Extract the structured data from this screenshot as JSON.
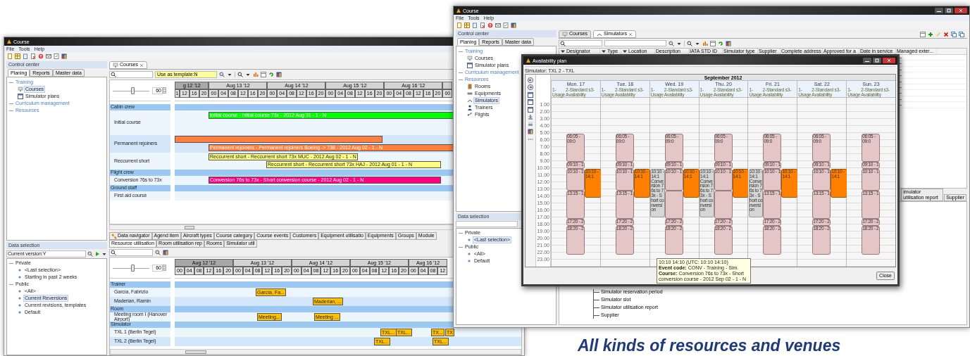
{
  "left_window": {
    "title": "Course",
    "menu": [
      "File",
      "Tools",
      "Help"
    ],
    "control_center": {
      "title": "Control center",
      "tabs": [
        {
          "label": "Planing",
          "selected": true
        },
        {
          "label": "Reports",
          "selected": false
        },
        {
          "label": "Master data",
          "selected": false
        }
      ],
      "tree": [
        {
          "label": "Training",
          "kind": "category",
          "selected": false,
          "children": [
            {
              "label": "Courses",
              "kind": "course",
              "selected": true
            },
            {
              "label": "Simulator plans",
              "kind": "plan",
              "selected": false
            }
          ]
        },
        {
          "label": "Curriculum management",
          "kind": "category",
          "selected": false
        },
        {
          "label": "Resources",
          "kind": "category",
          "selected": false
        }
      ]
    },
    "data_selection": {
      "title": "Data selection",
      "filter": "Current version:Y",
      "tree": [
        {
          "label": "Private",
          "kind": "folder",
          "selected": false,
          "children": [
            {
              "label": "<Last selection>",
              "kind": "filter",
              "selected": false
            },
            {
              "label": "Starting in past 2 weeks",
              "kind": "filter",
              "selected": false
            }
          ]
        },
        {
          "label": "Public",
          "kind": "folder",
          "selected": false,
          "children": [
            {
              "label": "<All>",
              "kind": "filter",
              "selected": false
            },
            {
              "label": "Current Reversions",
              "kind": "filter",
              "selected": true
            },
            {
              "label": "Current revisions, templates",
              "kind": "filter",
              "selected": false
            },
            {
              "label": "Default",
              "kind": "filter",
              "selected": false
            }
          ]
        }
      ]
    },
    "editor": {
      "tabs": [
        {
          "label": "Courses",
          "selected": true
        }
      ],
      "template_field": "Use as template:N",
      "planner": {
        "zoom": "60",
        "level": 0.55,
        "days": [
          {
            "label": "g 12 '12",
            "weekend": true,
            "hours": [
              "1",
              "12",
              "16",
              "20"
            ]
          },
          {
            "label": "Aug 13 '12",
            "weekend": false,
            "hours": [
              "00",
              "04",
              "08",
              "12",
              "16",
              "20"
            ]
          },
          {
            "label": "Aug 14 '12",
            "weekend": false,
            "hours": [
              "00",
              "04",
              "08",
              "12",
              "16",
              "20"
            ]
          },
          {
            "label": "Aug 15 '12",
            "weekend": false,
            "hours": [
              "00",
              "04",
              "08",
              "12",
              "16",
              "20"
            ]
          },
          {
            "label": "Aug 16 '12",
            "weekend": false,
            "hours": [
              "00",
              "04",
              "08",
              "12",
              "16",
              "20"
            ]
          },
          {
            "weekend": false,
            "hours": [
              "00"
            ]
          }
        ],
        "rows": [
          {
            "kind": "group",
            "label": "Cabin crew"
          },
          {
            "kind": "item",
            "label": "Initial course",
            "bars": [
              {
                "label": "Initial course - Initial course 73x - 2012 Aug 01 - 1 - N",
                "color": "#00ff00"
              }
            ]
          },
          {
            "kind": "item",
            "label": "Permanent rejoiners",
            "bars": [
              {
                "color": "#ff7f3f"
              },
              {
                "label": "Permanent rejoiners - Permanent rejoiners Boeing -> 738 - 2012 Aug 02 - 1 - N",
                "color": "#ff7f3f"
              }
            ]
          },
          {
            "kind": "item",
            "label": "Reccurrent short",
            "bars": [
              {
                "label": "Reccurrent short - Reccurrent short 73x MUC - 2012 Aug 02 - 1 - N",
                "color": "#ffff80"
              },
              {
                "label": "Reccurrent short - Reccurrent short 73x HAJ - 2012 Aug 01 - 1 - N",
                "color": "#ffff80"
              }
            ]
          },
          {
            "kind": "group",
            "label": "Flight crew"
          },
          {
            "kind": "item",
            "label": "Conversion 76s to 73x",
            "bars": [
              {
                "label": "Conversion 76s to 73x - Short conversion course - 2012 Aug 02 - 1 - N",
                "color": "#ff0080"
              }
            ]
          },
          {
            "kind": "group",
            "label": "Ground staff"
          },
          {
            "kind": "item",
            "label": "First aid course",
            "bars": []
          }
        ]
      }
    },
    "bottom_panel": {
      "tabs": [
        {
          "label": "Data navigator",
          "selected": false
        },
        {
          "label": "Agend item",
          "selected": false
        },
        {
          "label": "Aircraft types",
          "selected": false
        },
        {
          "label": "Course category",
          "selected": false
        },
        {
          "label": "Course events",
          "selected": false
        },
        {
          "label": "Customers",
          "selected": false
        },
        {
          "label": "Equipment utilisatio",
          "selected": false
        },
        {
          "label": "Equipments",
          "selected": false
        },
        {
          "label": "Groups",
          "selected": false
        },
        {
          "label": "Module",
          "selected": false
        },
        {
          "label": "Resource utilisation",
          "selected": true
        },
        {
          "label": "Room utilisation rep",
          "selected": false
        },
        {
          "label": "Rooms",
          "selected": false
        },
        {
          "label": "Simulator util",
          "selected": false
        }
      ],
      "planner": {
        "zoom": "60",
        "level": 0.55,
        "days": [
          {
            "label": "Aug 12 '12",
            "weekend": true,
            "hours": [
              "00",
              "04",
              "08",
              "12",
              "16",
              "20"
            ]
          },
          {
            "label": "Aug 13 '12",
            "weekend": false,
            "hours": [
              "00",
              "04",
              "08",
              "12",
              "16",
              "20"
            ]
          },
          {
            "label": "Aug 14 '12",
            "weekend": false,
            "hours": [
              "00",
              "04",
              "08",
              "12",
              "16",
              "20"
            ]
          },
          {
            "label": "Aug 15 '12",
            "weekend": false,
            "hours": [
              "00",
              "04",
              "08",
              "12",
              "16",
              "20"
            ]
          },
          {
            "label": "Aug 16 '12",
            "weekend": false,
            "hours": [
              "00",
              "04",
              "08",
              "12"
            ]
          }
        ],
        "rows": [
          {
            "kind": "group",
            "label": "Trainer"
          },
          {
            "kind": "item",
            "label": "García, Fabrizio",
            "bars": [
              {
                "label": "García, Fa...",
                "color": "#ffc000"
              }
            ]
          },
          {
            "kind": "item",
            "label": "Maderian, Ramin",
            "bars": [
              {
                "label": "Maderian, ...",
                "color": "#ffc000"
              }
            ]
          },
          {
            "kind": "group",
            "label": "Room"
          },
          {
            "kind": "item",
            "label": "Meeting room I (Hanover Airport)",
            "bars": [
              {
                "label": "Meeting...",
                "color": "#ffc000"
              },
              {
                "label": "Meeting ...",
                "color": "#ffc000"
              }
            ]
          },
          {
            "kind": "group",
            "label": "Simulator"
          },
          {
            "kind": "item",
            "label": "TXL 1 (Berlin Tegel)",
            "bars": [
              {
                "label": "TXL...",
                "color": "#ffc000"
              },
              {
                "label": "TXL...",
                "color": "#ffc000"
              },
              {
                "label": "TX...",
                "color": "#ffc000"
              },
              {
                "label": "TX",
                "color": "#ffc000"
              }
            ]
          },
          {
            "kind": "item",
            "label": "TXL 2 (Berlin Tegel)",
            "bars": [
              {
                "label": "TXL...",
                "color": "#ffc000"
              },
              {
                "label": "TXL...",
                "color": "#ffc000"
              }
            ]
          }
        ]
      }
    }
  },
  "right_window": {
    "title": "Course",
    "menu": [
      "File",
      "Tools",
      "Help"
    ],
    "control_center": {
      "title": "Control center",
      "tabs": [
        {
          "label": "Planing",
          "selected": true
        },
        {
          "label": "Reports",
          "selected": false
        },
        {
          "label": "Master data",
          "selected": false
        }
      ],
      "tree": [
        {
          "label": "Training",
          "kind": "category",
          "selected": false,
          "children": [
            {
              "label": "Courses",
              "kind": "course",
              "selected": false
            },
            {
              "label": "Simulator plans",
              "kind": "plan",
              "selected": false
            }
          ]
        },
        {
          "label": "Curriculum management",
          "kind": "category",
          "selected": false
        },
        {
          "label": "Resources",
          "kind": "category",
          "selected": false,
          "children": [
            {
              "label": "Rooms",
              "kind": "room",
              "selected": false
            },
            {
              "label": "Equipments",
              "kind": "equipment",
              "selected": false
            },
            {
              "label": "Simulators",
              "kind": "simulator",
              "selected": true
            },
            {
              "label": "Trainers",
              "kind": "trainer",
              "selected": false
            },
            {
              "label": "Flights",
              "kind": "flight",
              "selected": false
            }
          ]
        }
      ]
    },
    "data_selection": {
      "title": "Data selection",
      "tree": [
        {
          "label": "Private",
          "kind": "folder",
          "selected": false,
          "children": [
            {
              "label": "<Last selection>",
              "kind": "filter",
              "selected": true
            }
          ]
        },
        {
          "label": "Public",
          "kind": "folder",
          "selected": false,
          "children": [
            {
              "label": "<All>",
              "kind": "filter",
              "selected": false
            },
            {
              "label": "Default",
              "kind": "filter",
              "selected": false
            }
          ]
        }
      ]
    },
    "editor": {
      "tabs": [
        {
          "label": "Courses",
          "selected": false
        },
        {
          "label": "Simulators",
          "selected": true
        }
      ],
      "columns": [
        {
          "label": "Designator",
          "filter": true
        },
        {
          "label": "Type",
          "filter": true
        },
        {
          "label": "Location",
          "filter": true
        },
        {
          "label": "Description",
          "filter": false
        },
        {
          "label": "IATA STD ID",
          "filter": false
        },
        {
          "label": "Simulator type",
          "filter": false
        },
        {
          "label": "Supplier",
          "filter": false
        },
        {
          "label": "Complete address",
          "filter": false
        },
        {
          "label": "Approved for a",
          "filter": false
        },
        {
          "label": "Date in service",
          "filter": false
        },
        {
          "label": "Managed exter...",
          "filter": false
        }
      ],
      "managed_column_cells": [
        "–",
        "–",
        "–",
        "–",
        "–",
        "–",
        "–",
        "–",
        "–"
      ],
      "bottom_tabs": [
        {
          "label": "imulator utilisation report",
          "selected": false
        },
        {
          "label": "Supplier",
          "selected": false
        }
      ],
      "outline": [
        "Simulator reservation period",
        "Simulator slot",
        "Simulator utilisation report",
        "Supplier"
      ]
    }
  },
  "dialog": {
    "title": "Availability plan",
    "simulator": "Simulator: TXL 2 - TXL",
    "month": "September 2012",
    "hours": [
      "1.00",
      "2.00",
      "3.00",
      "4.00",
      "5.00",
      "6.00",
      "7.00",
      "8.00",
      "9.00",
      "10.00",
      "11.00",
      "12.00",
      "13.00",
      "14.00",
      "15.00",
      "16.00",
      "17.00",
      "18.00",
      "19.00",
      "20.00",
      "21.00",
      "22.00",
      "23.00"
    ],
    "days": [
      {
        "label": "Mon. 17",
        "columns": [
          "1-Usage",
          "2-Standard s3-Availability"
        ],
        "events": [
          {
            "kind": "slot",
            "label": "06:05 - 09:0"
          },
          {
            "kind": "slot",
            "label": "09:10 - 1"
          },
          {
            "kind": "slot",
            "label": "10:10 - 1"
          },
          {
            "kind": "slot",
            "label": "13:15 - 1"
          },
          {
            "kind": "slot",
            "label": "17:20 - 2"
          },
          {
            "kind": "slot",
            "label": "18:20 - 2"
          },
          {
            "kind": "booking",
            "label": "10:10 - 14:1"
          }
        ]
      },
      {
        "label": "Tue. 18",
        "columns": [
          "1-Usage",
          "2-Standard s3-Availability"
        ],
        "events": [
          {
            "kind": "slot",
            "label": "06:05 - 09:0"
          },
          {
            "kind": "slot",
            "label": "09:10 - 1"
          },
          {
            "kind": "slot",
            "label": "10:10 - 1"
          },
          {
            "kind": "slot",
            "label": "13:15 - 1"
          },
          {
            "kind": "slot",
            "label": "17:20 - 2"
          },
          {
            "kind": "slot",
            "label": "18:20 - 2"
          },
          {
            "kind": "booking",
            "label": "10:10 - 14:1"
          }
        ]
      },
      {
        "label": "Wed. 19",
        "columns": [
          "1-Usage",
          "2-Standard s3-Availability"
        ],
        "events": [
          {
            "kind": "course",
            "label": "10:10 - 14:1",
            "body": "Conversion 76s to 73x - Short conversion"
          },
          {
            "kind": "slot",
            "label": "06:05 - 09:0"
          },
          {
            "kind": "slot",
            "label": "09:10 - 1"
          },
          {
            "kind": "slot",
            "label": "10:10 - 1"
          },
          {
            "kind": "slot"
          },
          {
            "kind": "slot",
            "label": "17:20 - 2"
          },
          {
            "kind": "slot",
            "label": "18:20 - 2"
          },
          {
            "kind": "booking",
            "label": "10:10 - 14:1"
          }
        ]
      },
      {
        "label": "Thu. 20",
        "columns": [
          "1-Usage",
          "2-Standard s3-Availability"
        ],
        "events": [
          {
            "kind": "course",
            "label": "10:10 - 14:1",
            "body": "Conversion 76s to 73x - Short conversion"
          },
          {
            "kind": "slot",
            "label": "06:05 - 09:0"
          },
          {
            "kind": "slot",
            "label": "09:10 - 1"
          },
          {
            "kind": "slot",
            "label": "10:10 - 1"
          },
          {
            "kind": "slot"
          },
          {
            "kind": "slot",
            "label": "17:20 - 2"
          },
          {
            "kind": "slot",
            "label": "18:20 - 2"
          },
          {
            "kind": "booking",
            "label": "10:10 - 14:1"
          }
        ]
      },
      {
        "label": "Fri. 21",
        "columns": [
          "1-Usage",
          "2-Standard s3-Availability"
        ],
        "events": [
          {
            "kind": "course",
            "label": "10:10 - 14:1",
            "body": "Conversion 76s to 73x - Short conversion"
          },
          {
            "kind": "slot",
            "label": "06:05 - 09:0"
          },
          {
            "kind": "slot",
            "label": "09:10 - 1"
          },
          {
            "kind": "slot",
            "label": "10:10 - 1"
          },
          {
            "kind": "slot",
            "label": "13:15 - 1"
          },
          {
            "kind": "slot",
            "label": "17:20 - 2"
          },
          {
            "kind": "slot",
            "label": "18:20 - 2"
          },
          {
            "kind": "booking",
            "label": "10:10 - 14:1"
          }
        ]
      },
      {
        "label": "Sat. 22",
        "columns": [
          "1-Usage",
          "2-Standard s3-Availability"
        ],
        "events": [
          {
            "kind": "slot",
            "label": "06:05 - 09:0"
          },
          {
            "kind": "slot",
            "label": "09:10 - 1"
          },
          {
            "kind": "slot",
            "label": "10:10 - 1"
          },
          {
            "kind": "slot",
            "label": "13:15 - 1"
          },
          {
            "kind": "slot",
            "label": "17:20 - 2"
          },
          {
            "kind": "slot",
            "label": "18:20 - 2"
          },
          {
            "kind": "booking",
            "label": "10:10 - 14:1"
          }
        ]
      },
      {
        "label": "Sun. 23",
        "columns": [
          "1-Usage",
          "2-Standard s3-Availability"
        ],
        "events": [
          {
            "kind": "slot",
            "label": "06:05 - 09:0"
          },
          {
            "kind": "slot",
            "label": "09:10 - 1"
          },
          {
            "kind": "slot",
            "label": "10:10 - 1"
          },
          {
            "kind": "slot",
            "label": "13:15 - 1"
          },
          {
            "kind": "slot",
            "label": "17:20 - 2"
          },
          {
            "kind": "slot",
            "label": "18:20 - 2"
          }
        ]
      }
    ],
    "tooltip": [
      "10:10 14:10 (UTC: 10:10 14:10)",
      "**Event code:** CONV - Training - Sim.",
      "**Course:** Conversion 76s to 73x - Short conversion course - 2012 Sep 02 - 1 - N"
    ],
    "close": "Close"
  },
  "caption": "All kinds of resources and venues"
}
